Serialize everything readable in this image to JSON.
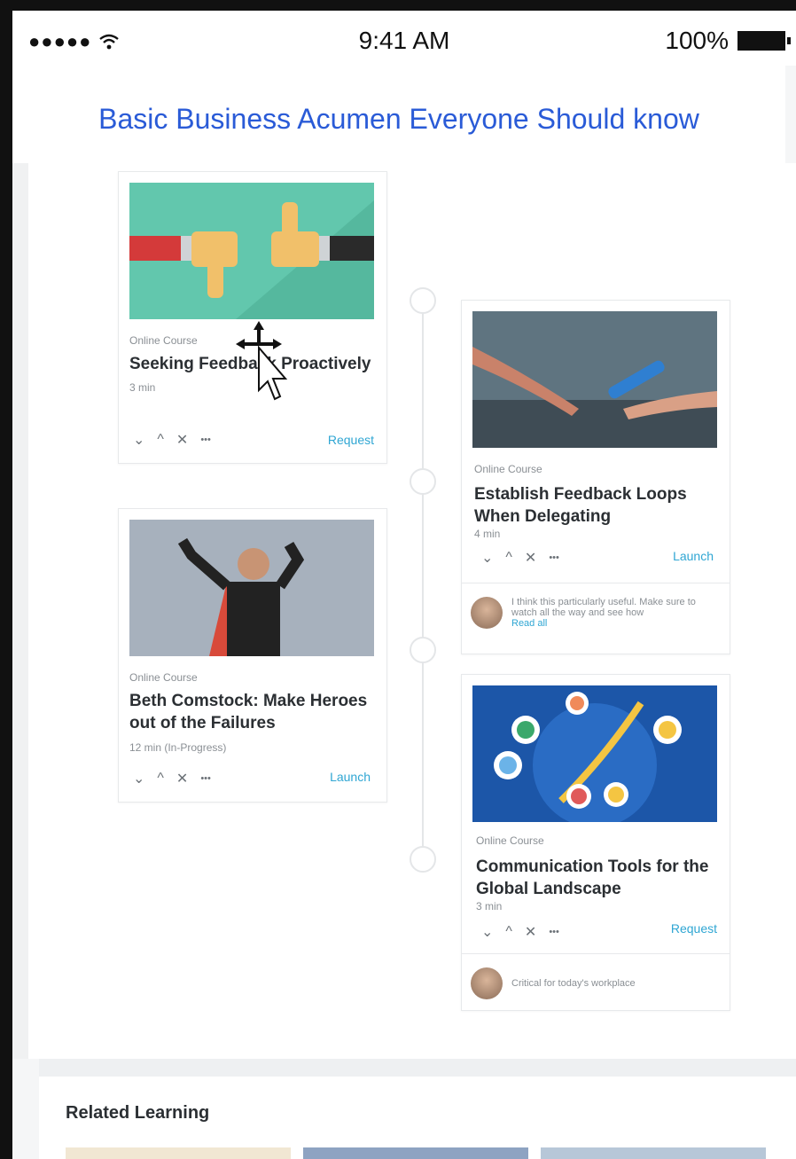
{
  "status_bar": {
    "signal": "●●●●● ",
    "time": "9:41 AM",
    "battery": "100%"
  },
  "header": {
    "title": "Basic Business Acumen Everyone Should know"
  },
  "icons": {
    "wifi": "wifi-icon",
    "battery": "battery-icon",
    "chevron_down": "⌄",
    "chevron_up": "^",
    "close": "✕",
    "more": "•••"
  },
  "cards": [
    {
      "type": "Online Course",
      "title": "Seeking Feedback Proactively",
      "duration": "3 min",
      "action": "Request"
    },
    {
      "type": "Online Course",
      "title": "Establish Feedback Loops When Delegating",
      "duration": "4 min",
      "action": "Launch",
      "comment": {
        "text": "I think this particularly useful. Make sure to watch all the way and see how",
        "link": "Read all"
      }
    },
    {
      "type": "Online Course",
      "title": "Beth Comstock: Make Heroes out of the Failures",
      "duration": "12 min (In-Progress)",
      "action": "Launch"
    },
    {
      "type": "Online Course",
      "title": "Communication Tools for the Global Landscape",
      "duration": "3 min",
      "action": "Request",
      "comment": {
        "text": "Critical for today's workplace"
      }
    }
  ],
  "related": {
    "title": "Related Learning"
  },
  "colors": {
    "accent": "#2a5bd7",
    "link": "#2fa6d3"
  }
}
